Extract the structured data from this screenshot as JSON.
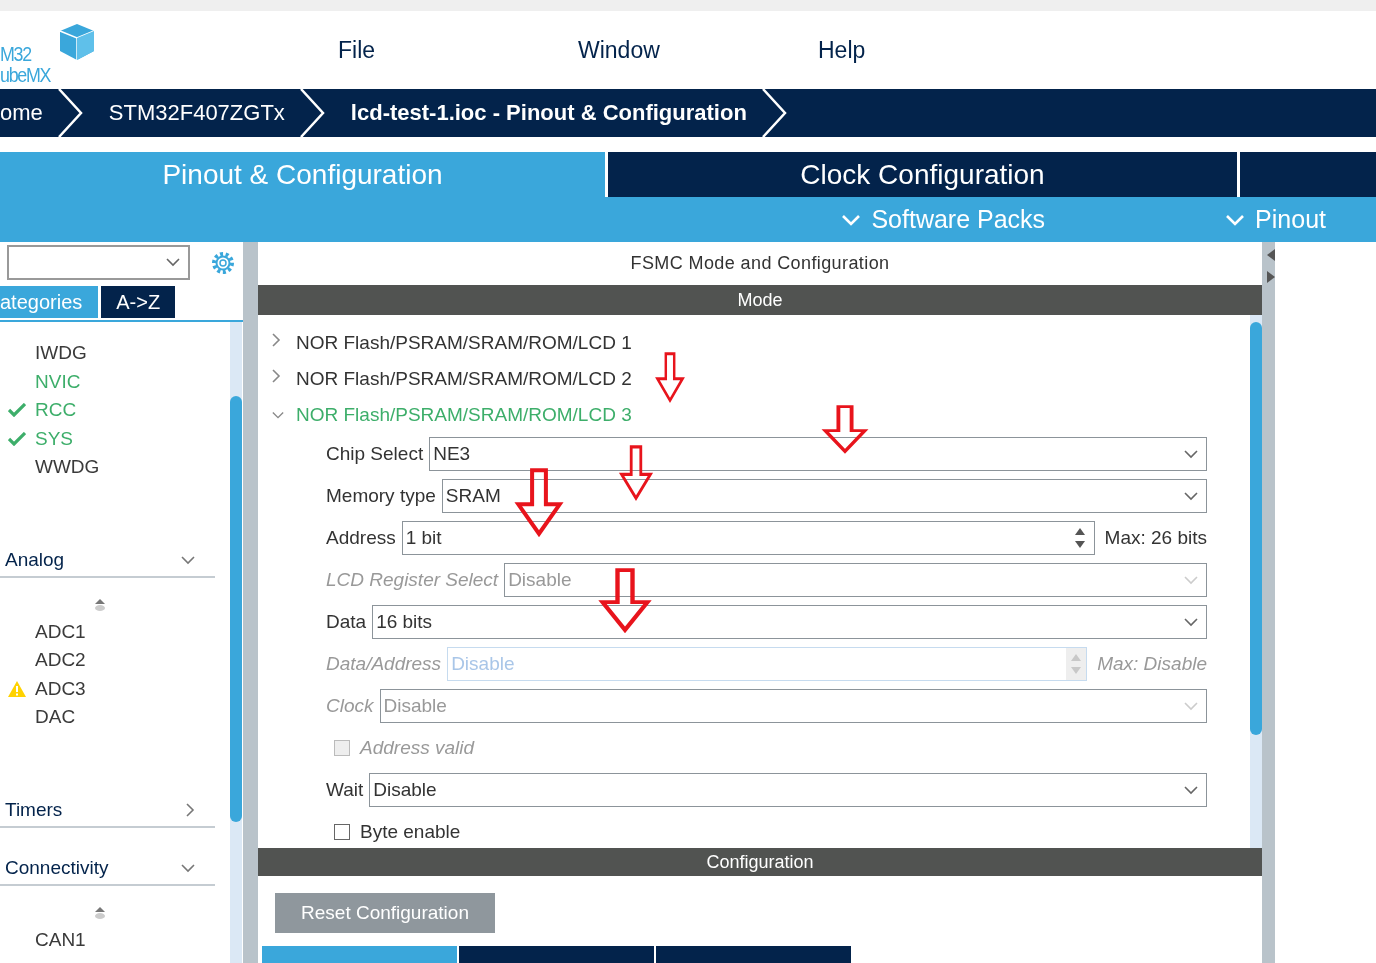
{
  "logo": {
    "line_1": "M32",
    "line_2": "ubeMX"
  },
  "menu": [
    "File",
    "Window",
    "Help"
  ],
  "breadcrumbs": [
    {
      "label": "ome",
      "current": false
    },
    {
      "label": "STM32F407ZGTx",
      "current": false
    },
    {
      "label": "lcd-test-1.ioc - Pinout & Configuration",
      "current": true
    }
  ],
  "tabs": [
    {
      "label": "Pinout & Configuration",
      "selected": true
    },
    {
      "label": "Clock Configuration",
      "selected": false
    }
  ],
  "sub_menu": [
    "Software Packs",
    "Pinout"
  ],
  "sidebar": {
    "list_tabs": [
      {
        "label": "ategories",
        "selected": true
      },
      {
        "label": "A->Z",
        "selected": false
      }
    ],
    "items": [
      {
        "label": "IWDG",
        "configured": false,
        "checked": false,
        "warning": false
      },
      {
        "label": "NVIC",
        "configured": true,
        "checked": false,
        "warning": false
      },
      {
        "label": "RCC",
        "configured": true,
        "checked": true,
        "warning": false
      },
      {
        "label": "SYS",
        "configured": true,
        "checked": true,
        "warning": false
      },
      {
        "label": "WWDG",
        "configured": false,
        "checked": false,
        "warning": false
      }
    ],
    "categories": [
      {
        "title": "Analog",
        "expanded": true,
        "items": [
          {
            "label": "ADC1",
            "configured": false,
            "checked": false,
            "warning": false
          },
          {
            "label": "ADC2",
            "configured": false,
            "checked": false,
            "warning": false
          },
          {
            "label": "ADC3",
            "configured": false,
            "checked": false,
            "warning": true
          },
          {
            "label": "DAC",
            "configured": false,
            "checked": false,
            "warning": false
          }
        ]
      },
      {
        "title": "Timers",
        "expanded": false
      },
      {
        "title": "Connectivity",
        "expanded": true,
        "items": [
          {
            "label": "CAN1",
            "configured": false,
            "checked": false,
            "warning": false
          }
        ]
      }
    ]
  },
  "panel": {
    "title": "FSMC Mode and Configuration",
    "mode_header": "Mode",
    "tree": [
      {
        "label": "NOR Flash/PSRAM/SRAM/ROM/LCD 1",
        "expanded": false
      },
      {
        "label": "NOR Flash/PSRAM/SRAM/ROM/LCD 2",
        "expanded": false
      },
      {
        "label": "NOR Flash/PSRAM/SRAM/ROM/LCD 3",
        "expanded": true,
        "fields": [
          {
            "kind": "combo",
            "label": "Chip Select",
            "value": "NE3",
            "disabled": false
          },
          {
            "kind": "combo",
            "label": "Memory type",
            "value": "SRAM",
            "disabled": false
          },
          {
            "kind": "spinner",
            "label": "Address",
            "value": "1 bit",
            "max": "Max: 26 bits",
            "disabled": false
          },
          {
            "kind": "combo",
            "label": "LCD Register Select",
            "value": "Disable",
            "disabled": true
          },
          {
            "kind": "combo",
            "label": "Data",
            "value": "16 bits",
            "disabled": false
          },
          {
            "kind": "spinner",
            "label": "Data/Address",
            "value": "Disable",
            "max": "Max: Disable",
            "disabled": true
          },
          {
            "kind": "combo",
            "label": "Clock",
            "value": "Disable",
            "disabled": true
          },
          {
            "kind": "checkbox",
            "label": "Address valid",
            "checked": false,
            "disabled": true
          },
          {
            "kind": "combo",
            "label": "Wait",
            "value": "Disable",
            "disabled": false
          },
          {
            "kind": "checkbox",
            "label": "Byte enable",
            "checked": false,
            "disabled": false
          }
        ]
      }
    ],
    "config_header": "Configuration",
    "reset_button": "Reset Configuration",
    "config_tabs": [
      {
        "selected": true
      },
      {
        "selected": false
      },
      {
        "selected": false
      }
    ]
  },
  "annotations": [
    {
      "kind": "arrow"
    },
    {
      "kind": "arrow"
    },
    {
      "kind": "arrow"
    },
    {
      "kind": "arrow"
    },
    {
      "kind": "arrow"
    }
  ]
}
